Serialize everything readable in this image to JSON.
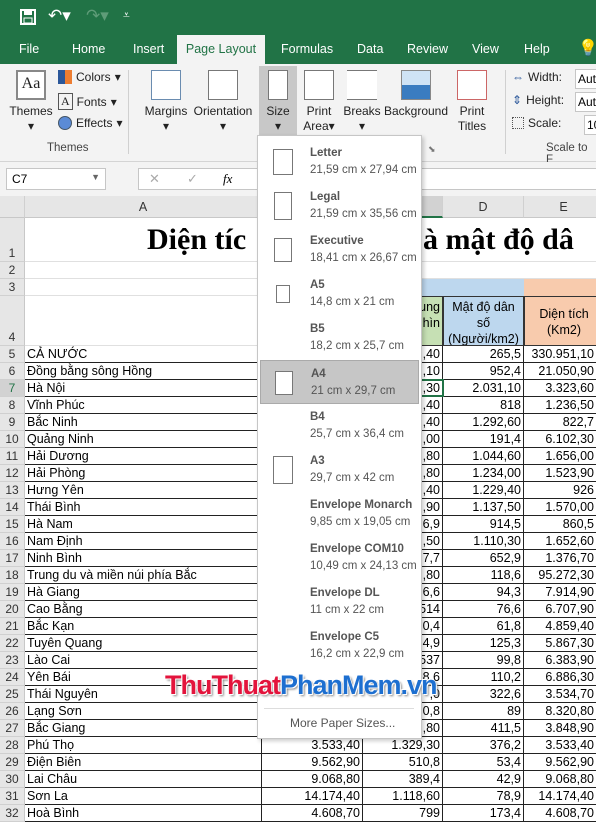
{
  "qat": {
    "save": "save-icon",
    "undo": "undo-icon",
    "redo": "redo-icon",
    "customize": "customize-icon"
  },
  "tabs": [
    "File",
    "Home",
    "Insert",
    "Page Layout",
    "Formulas",
    "Data",
    "Review",
    "View",
    "Help"
  ],
  "active_tab": "Page Layout",
  "ribbon": {
    "themes": "Themes",
    "colors": "Colors",
    "fonts": "Fonts",
    "effects": "Effects",
    "themes_group": "Themes",
    "margins": "Margins",
    "orientation": "Orientation",
    "size": "Size",
    "print": "Print",
    "area": "Area",
    "breaks": "Breaks",
    "background": "Background",
    "print2": "Print",
    "titles": "Titles",
    "width_label": "Width:",
    "width_value": "Aut",
    "height_label": "Height:",
    "height_value": "Aut",
    "scale_label": "Scale:",
    "scale_value": "10",
    "scale_group": "Scale to F"
  },
  "formula_bar": {
    "name_box": "C7",
    "fx": "fx",
    "cancel": "✕",
    "enter": "✓"
  },
  "size_menu": {
    "items": [
      {
        "name": "Letter",
        "dims": "21,59 cm x 27,94 cm"
      },
      {
        "name": "Legal",
        "dims": "21,59 cm x 35,56 cm"
      },
      {
        "name": "Executive",
        "dims": "18,41 cm x 26,67 cm"
      },
      {
        "name": "A5",
        "dims": "14,8 cm x 21 cm"
      },
      {
        "name": "B5",
        "dims": "18,2 cm x 25,7 cm"
      },
      {
        "name": "A4",
        "dims": "21 cm x 29,7 cm"
      },
      {
        "name": "B4",
        "dims": "25,7 cm x 36,4 cm"
      },
      {
        "name": "A3",
        "dims": "29,7 cm x 42 cm"
      },
      {
        "name": "Envelope Monarch",
        "dims": "9,85 cm x 19,05 cm"
      },
      {
        "name": "Envelope COM10",
        "dims": "10,49 cm x 24,13 cm"
      },
      {
        "name": "Envelope DL",
        "dims": "11 cm x 22 cm"
      },
      {
        "name": "Envelope C5",
        "dims": "16,2 cm x 22,9 cm"
      }
    ],
    "selected": "A4",
    "more": "More Paper Sizes..."
  },
  "sheet": {
    "columns": [
      "A",
      "D",
      "E"
    ],
    "title_left": "Diện tíc",
    "title_right": "à mật độ dâ",
    "c4_partial": [
      "ung",
      "hìn"
    ],
    "d4": "Mật độ dân số (Người/km2)",
    "e4": "Diện tích (Km2)",
    "rows": [
      {
        "n": 5,
        "a": "CẢ NƯỚC",
        "c": ",40",
        "d": "265,5",
        "e": "330.951,10"
      },
      {
        "n": 6,
        "a": "Đồng bằng sông Hồng",
        "c": ",10",
        "d": "952,4",
        "e": "21.050,90"
      },
      {
        "n": 7,
        "a": "Hà Nội",
        "c": ",30",
        "d": "2.031,10",
        "e": "3.323,60"
      },
      {
        "n": 8,
        "a": "Vĩnh Phúc",
        "c": ",40",
        "d": "818",
        "e": "1.236,50"
      },
      {
        "n": 9,
        "a": "Bắc Ninh",
        "c": ",40",
        "d": "1.292,60",
        "e": "822,7"
      },
      {
        "n": 10,
        "a": "Quảng Ninh",
        "c": ",00",
        "d": "191,4",
        "e": "6.102,30"
      },
      {
        "n": 11,
        "a": "Hải Dương",
        "c": ",80",
        "d": "1.044,60",
        "e": "1.656,00"
      },
      {
        "n": 12,
        "a": "Hải Phòng",
        "c": ",80",
        "d": "1.234,00",
        "e": "1.523,90"
      },
      {
        "n": 13,
        "a": "Hưng Yên",
        "c": ",40",
        "d": "1.229,40",
        "e": "926"
      },
      {
        "n": 14,
        "a": "Thái Bình",
        "c": ",90",
        "d": "1.137,50",
        "e": "1.570,00"
      },
      {
        "n": 15,
        "a": "Hà Nam",
        "c": "6,9",
        "d": "914,5",
        "e": "860,5"
      },
      {
        "n": 16,
        "a": "Nam Định",
        "c": ",50",
        "d": "1.110,30",
        "e": "1.652,60"
      },
      {
        "n": 17,
        "a": "Ninh Bình",
        "c": "7,7",
        "d": "652,9",
        "e": "1.376,70"
      },
      {
        "n": 18,
        "a": "Trung du và miền núi phía Bắc",
        "c": ",80",
        "d": "118,6",
        "e": "95.272,30"
      },
      {
        "n": 19,
        "a": "Hà Giang",
        "c": "6,6",
        "d": "94,3",
        "e": "7.914,90"
      },
      {
        "n": 20,
        "a": "Cao Bằng",
        "c": "514",
        "d": "76,6",
        "e": "6.707,90"
      },
      {
        "n": 21,
        "a": "Bắc Kạn",
        "c": "0,4",
        "d": "61,8",
        "e": "4.859,40"
      },
      {
        "n": 22,
        "a": "Tuyên Quang",
        "c": "4,9",
        "d": "125,3",
        "e": "5.867,30"
      },
      {
        "n": 23,
        "a": "Lào Cai",
        "c": "537",
        "d": "99,8",
        "e": "6.383,90"
      },
      {
        "n": 24,
        "a": "Yên Bái",
        "c": "8,6",
        "d": "110,2",
        "e": "6.886,30"
      },
      {
        "n": 25,
        "a": "Thái Nguyên",
        "c": ",0",
        "d": "322,6",
        "e": "3.534,70"
      },
      {
        "n": 26,
        "a": "Lạng Sơn",
        "c": "0,8",
        "d": "89",
        "e": "8.320,80"
      },
      {
        "n": 27,
        "a": "Bắc Giang",
        "c": ",80",
        "d": "411,5",
        "e": "3.848,90"
      },
      {
        "n": 28,
        "a": "Phú Thọ",
        "b": "3.533,40",
        "c": "1.329,30",
        "d": "376,2",
        "e": "3.533,40"
      },
      {
        "n": 29,
        "a": "Điện Biên",
        "b": "9.562,90",
        "c": "510,8",
        "d": "53,4",
        "e": "9.562,90"
      },
      {
        "n": 30,
        "a": "Lai Châu",
        "b": "9.068,80",
        "c": "389,4",
        "d": "42,9",
        "e": "9.068,80"
      },
      {
        "n": 31,
        "a": "Sơn La",
        "b": "14.174,40",
        "c": "1.118,60",
        "d": "78,9",
        "e": "14.174,40"
      },
      {
        "n": 32,
        "a": "Hoà Bình",
        "b": "4.608,70",
        "c": "799",
        "d": "173,4",
        "e": "4.608,70"
      }
    ]
  },
  "watermark": {
    "part1": "ThuThuat",
    "part2": "PhanMem",
    "part3": ".vn"
  },
  "colors": {
    "brand": "#217346",
    "header_blue": "#bdd7ee",
    "header_orange": "#f8cbad",
    "header_green": "#c6e0b4"
  }
}
